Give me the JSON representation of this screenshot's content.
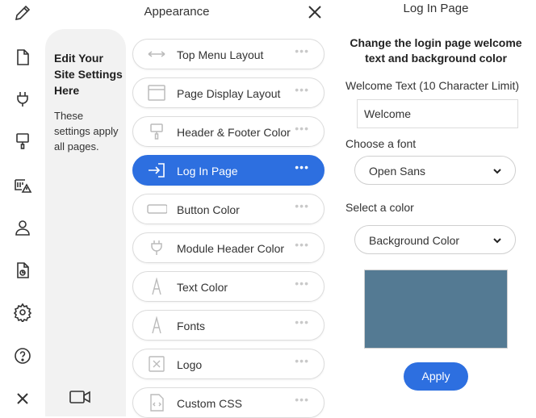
{
  "rail": {
    "icons": [
      "pencil-icon",
      "page-icon",
      "plug-icon",
      "paint-roller-icon",
      "warning-list-icon",
      "user-icon",
      "file-chart-icon",
      "gear-icon",
      "help-icon",
      "close-icon"
    ]
  },
  "help": {
    "title": "Edit Your Site Settings Here",
    "text": "These settings apply all pages."
  },
  "appearance": {
    "title": "Appearance",
    "items": [
      {
        "label": "Top Menu Layout",
        "icon": "arrows-horizontal-icon",
        "active": false
      },
      {
        "label": "Page Display Layout",
        "icon": "layout-window-icon",
        "active": false
      },
      {
        "label": "Header & Footer Color",
        "icon": "paint-roller-icon",
        "active": false
      },
      {
        "label": "Log In Page",
        "icon": "login-arrow-icon",
        "active": true
      },
      {
        "label": "Button Color",
        "icon": "button-rect-icon",
        "active": false
      },
      {
        "label": "Module Header Color",
        "icon": "plug-icon",
        "active": false
      },
      {
        "label": "Text Color",
        "icon": "letter-a-icon",
        "active": false
      },
      {
        "label": "Fonts",
        "icon": "letter-a-icon",
        "active": false
      },
      {
        "label": "Logo",
        "icon": "image-box-icon",
        "active": false
      },
      {
        "label": "Custom CSS",
        "icon": "code-file-icon",
        "active": false
      }
    ],
    "dots": "•••"
  },
  "login": {
    "title": "Log In Page",
    "heading": "Change the login page welcome text and background color",
    "welcome_label": "Welcome Text (10 Character Limit)",
    "welcome_value": "Welcome",
    "font_label": "Choose a font",
    "font_value": "Open Sans",
    "color_label": "Select a color",
    "color_value": "Background Color",
    "swatch_color": "#547a93",
    "apply_label": "Apply"
  },
  "colors": {
    "accent": "#2d6fe0",
    "panel": "#f2f2f2"
  }
}
